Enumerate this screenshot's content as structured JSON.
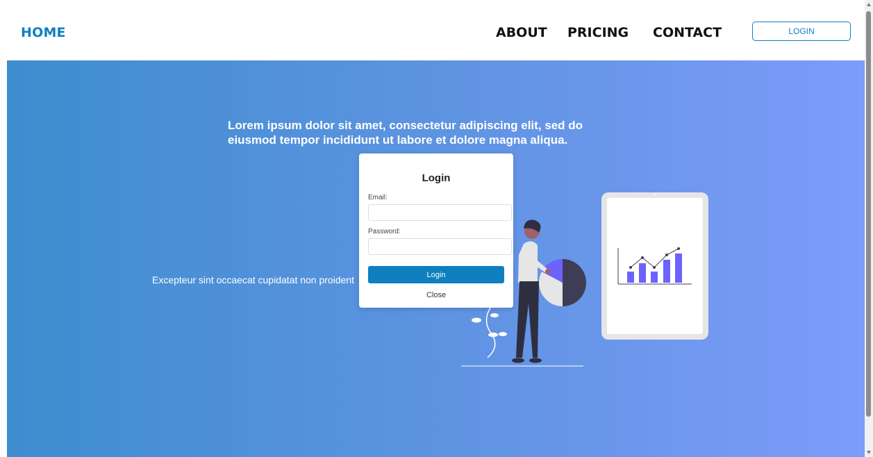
{
  "nav": {
    "home": "HOME",
    "links": [
      "ABOUT",
      "PRICING",
      "CONTACT"
    ],
    "login_button": "LOGIN"
  },
  "hero": {
    "heading": "Lorem ipsum dolor sit amet, consectetur adipiscing elit, sed do eiusmod tempor incididunt ut labore et dolore magna aliqua.",
    "paragraph": "Excepteur sint occaecat cupidatat non proident"
  },
  "modal": {
    "title": "Login",
    "email_label": "Email:",
    "password_label": "Password:",
    "submit_label": "Login",
    "close_label": "Close"
  },
  "colors": {
    "brand": "#0f7fbf",
    "hero_gradient_start": "#3e8dcf",
    "hero_gradient_end": "#7d9cfb",
    "illustration_accent": "#6c63ff"
  },
  "icons": {
    "illustration": "person-with-pie-chart",
    "tablet": "tablet-with-bar-chart"
  }
}
